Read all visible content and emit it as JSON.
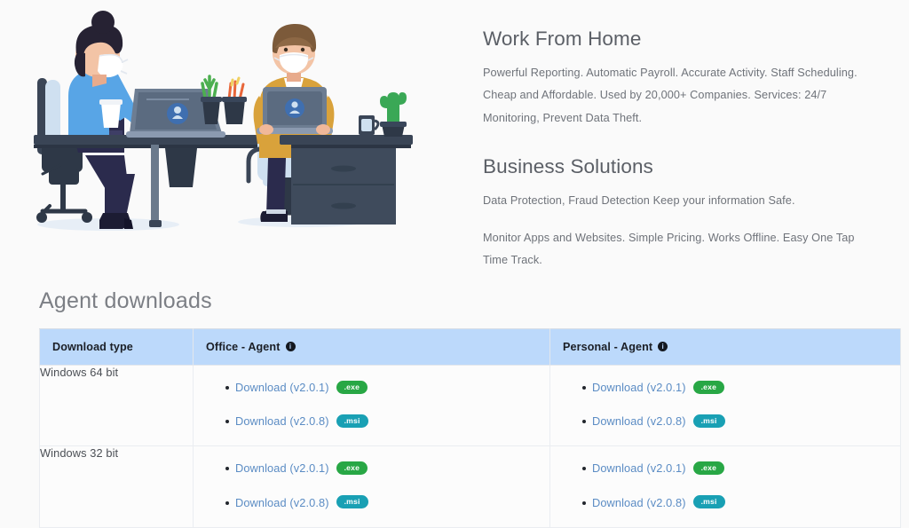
{
  "hero": {
    "illustration_name": "work-from-home-illustration",
    "sections": [
      {
        "title": "Work From Home",
        "paragraphs": [
          "Powerful Reporting. Automatic Payroll. Accurate Activity. Staff Scheduling. Cheap and Affordable. Used by 20,000+ Companies. Services: 24/7 Monitoring, Prevent Data Theft."
        ]
      },
      {
        "title": "Business Solutions",
        "paragraphs": [
          "Data Protection, Fraud Detection Keep your information Safe.",
          "Monitor Apps and Websites. Simple Pricing. Works Offline. Easy One Tap Time Track."
        ]
      }
    ]
  },
  "downloads": {
    "heading": "Agent downloads",
    "columns": [
      {
        "label": "Download type",
        "info": false
      },
      {
        "label": "Office - Agent",
        "info": true,
        "info_glyph": "i"
      },
      {
        "label": "Personal - Agent",
        "info": true,
        "info_glyph": "i"
      }
    ],
    "rows": [
      {
        "type": "Windows 64 bit",
        "office": [
          {
            "label": "Download (v2.0.1)",
            "badge": ".exe",
            "badge_kind": "exe"
          },
          {
            "label": "Download (v2.0.8)",
            "badge": ".msi",
            "badge_kind": "msi"
          }
        ],
        "personal": [
          {
            "label": "Download (v2.0.1)",
            "badge": ".exe",
            "badge_kind": "exe"
          },
          {
            "label": "Download (v2.0.8)",
            "badge": ".msi",
            "badge_kind": "msi"
          }
        ]
      },
      {
        "type": "Windows 32 bit",
        "office": [
          {
            "label": "Download (v2.0.1)",
            "badge": ".exe",
            "badge_kind": "exe"
          },
          {
            "label": "Download (v2.0.8)",
            "badge": ".msi",
            "badge_kind": "msi"
          }
        ],
        "personal": [
          {
            "label": "Download (v2.0.1)",
            "badge": ".exe",
            "badge_kind": "exe"
          },
          {
            "label": "Download (v2.0.8)",
            "badge": ".msi",
            "badge_kind": "msi"
          }
        ]
      }
    ]
  },
  "colors": {
    "page_background": "#fafafa",
    "header_background": "#bcd9fb",
    "link": "#5b8cc4",
    "badge_exe": "#28a745",
    "badge_msi": "#19a0b4",
    "heading_text": "#7c7f85",
    "body_text": "#6f737a"
  }
}
